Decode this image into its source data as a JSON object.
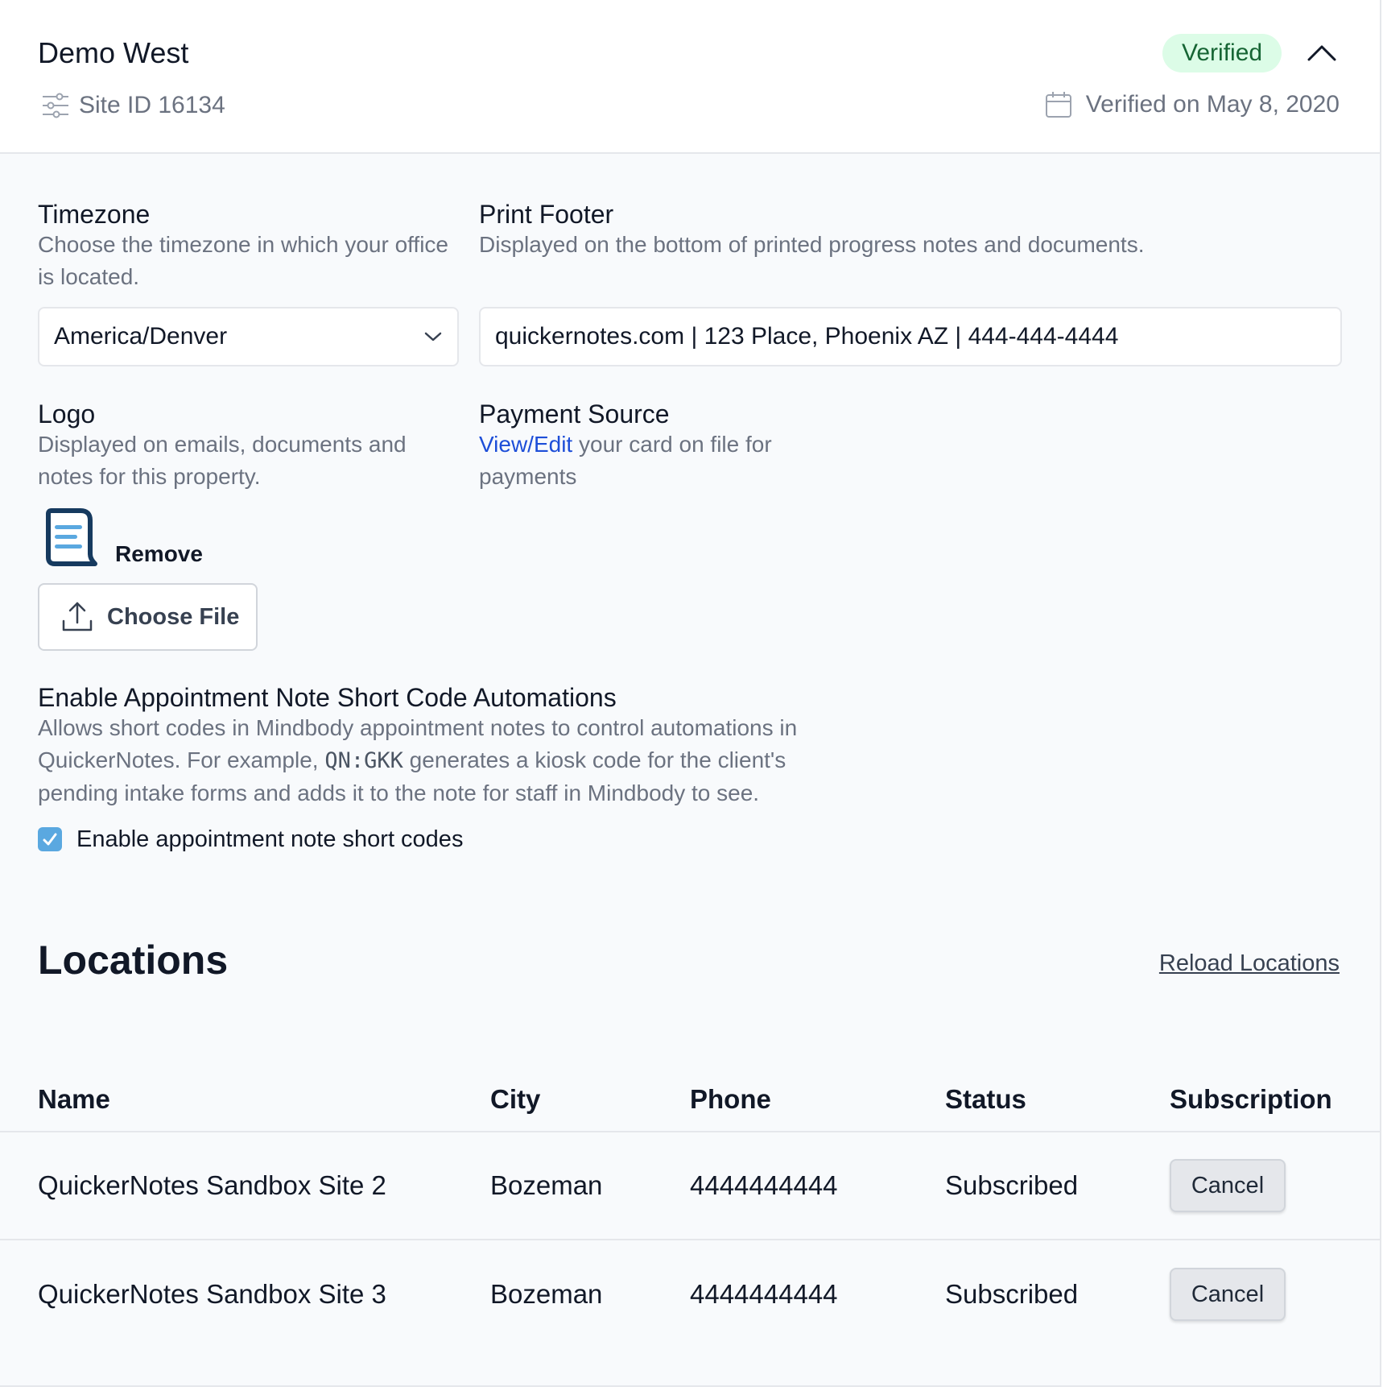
{
  "header": {
    "site_name": "Demo West",
    "site_id": "Site ID 16134",
    "badge": "Verified",
    "verified_on": "Verified on May 8, 2020",
    "icons": {
      "site_id": "sliders-icon",
      "verified_on": "calendar-icon",
      "collapse": "chevron-up-icon"
    },
    "colors": {
      "badge_bg": "#dcfce7",
      "badge_text": "#166534"
    }
  },
  "timezone": {
    "label": "Timezone",
    "help": "Choose the timezone in which your office is located.",
    "value": "America/Denver"
  },
  "print_footer": {
    "label": "Print Footer",
    "help": "Displayed on the bottom of printed progress notes and documents.",
    "value": "quickernotes.com | 123 Place, Phoenix AZ | 444-444-4444"
  },
  "logo": {
    "label": "Logo",
    "help": "Displayed on emails, documents and notes for this property.",
    "remove_label": "Remove",
    "choose_file_label": "Choose File",
    "icons": {
      "logo": "document-logo-icon",
      "upload": "upload-icon"
    }
  },
  "payment_source": {
    "label": "Payment Source",
    "link_text": "View/Edit",
    "help_rest": " your card on file for payments"
  },
  "short_codes": {
    "label": "Enable Appointment Note Short Code Automations",
    "help_part1": "Allows short codes in Mindbody appointment notes to control automations in QuickerNotes. For example, ",
    "code": "QN:GKK",
    "help_part2": " generates a kiosk code for the client's pending intake forms and adds it to the note for staff in Mindbody to see.",
    "checkbox_label": "Enable appointment note short codes",
    "checked": true
  },
  "locations": {
    "title": "Locations",
    "reload_label": "Reload Locations",
    "columns": [
      "Name",
      "City",
      "Phone",
      "Status",
      "Subscription"
    ],
    "rows": [
      {
        "name": "QuickerNotes Sandbox Site 2",
        "city": "Bozeman",
        "phone": "4444444444",
        "status": "Subscribed",
        "action": "Cancel"
      },
      {
        "name": "QuickerNotes Sandbox Site 3",
        "city": "Bozeman",
        "phone": "4444444444",
        "status": "Subscribed",
        "action": "Cancel"
      }
    ]
  }
}
